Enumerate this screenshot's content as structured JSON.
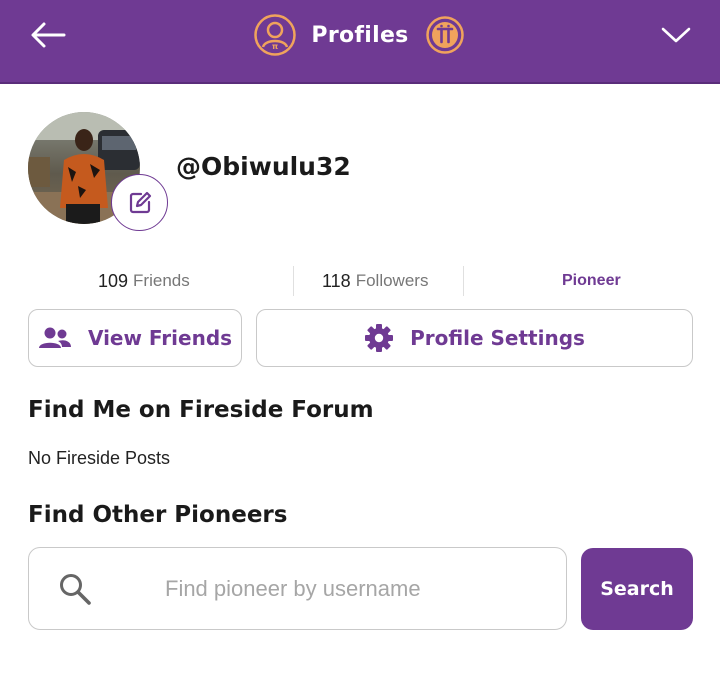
{
  "header": {
    "title": "Profiles",
    "back_icon": "arrow-left-icon",
    "profile_icon": "user-circle-icon",
    "pi_icon": "pi-coin-icon",
    "dropdown_icon": "chevron-down-icon"
  },
  "profile": {
    "username": "@Obiwulu32",
    "avatar_icon": "profile-photo",
    "edit_icon": "pencil-square-icon"
  },
  "stats": {
    "friends_count": "109",
    "friends_label": "Friends",
    "followers_count": "118",
    "followers_label": "Followers",
    "role": "Pioneer"
  },
  "actions": {
    "view_friends_label": "View Friends",
    "view_friends_icon": "people-icon",
    "profile_settings_label": "Profile Settings",
    "profile_settings_icon": "gear-icon"
  },
  "fireside": {
    "title": "Find Me on Fireside Forum",
    "empty_text": "No Fireside Posts"
  },
  "find_pioneers": {
    "title": "Find Other Pioneers",
    "placeholder": "Find pioneer by username",
    "value": "",
    "search_label": "Search",
    "search_icon": "magnifier-icon"
  },
  "colors": {
    "brand": "#6f3a93",
    "accent": "#f0a35c"
  }
}
